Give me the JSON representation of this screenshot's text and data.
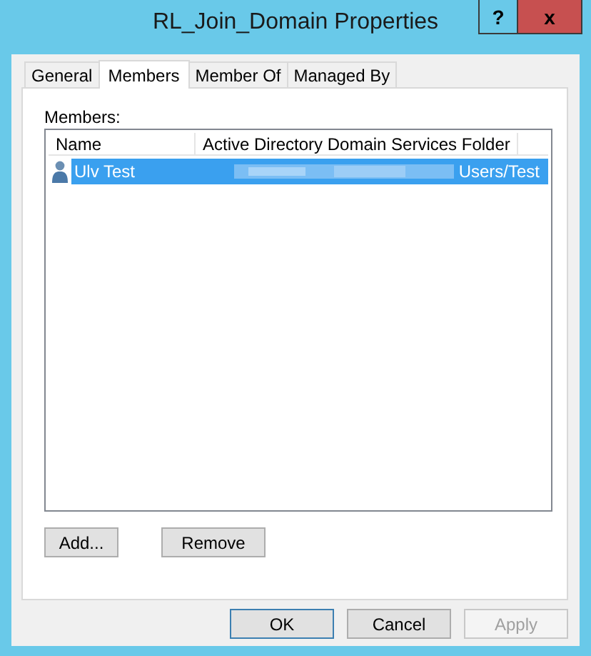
{
  "window": {
    "title": "RL_Join_Domain Properties",
    "help_button": "?",
    "close_button": "x"
  },
  "tabs": [
    {
      "label": "General",
      "selected": false
    },
    {
      "label": "Members",
      "selected": true
    },
    {
      "label": "Member Of",
      "selected": false
    },
    {
      "label": "Managed By",
      "selected": false
    }
  ],
  "members_label": "Members:",
  "list": {
    "columns": [
      "Name",
      "Active Directory Domain Services Folder"
    ],
    "rows": [
      {
        "name": "Ulv Test",
        "folder": "Users/Test",
        "redacted": true,
        "selected": true
      }
    ]
  },
  "list_buttons": [
    {
      "label": "Add...",
      "disabled": false
    },
    {
      "label": "Remove",
      "disabled": false
    }
  ],
  "dialog_buttons": [
    {
      "label": "OK",
      "disabled": false,
      "default": true
    },
    {
      "label": "Cancel",
      "disabled": false,
      "default": false
    },
    {
      "label": "Apply",
      "disabled": true,
      "default": false
    }
  ]
}
